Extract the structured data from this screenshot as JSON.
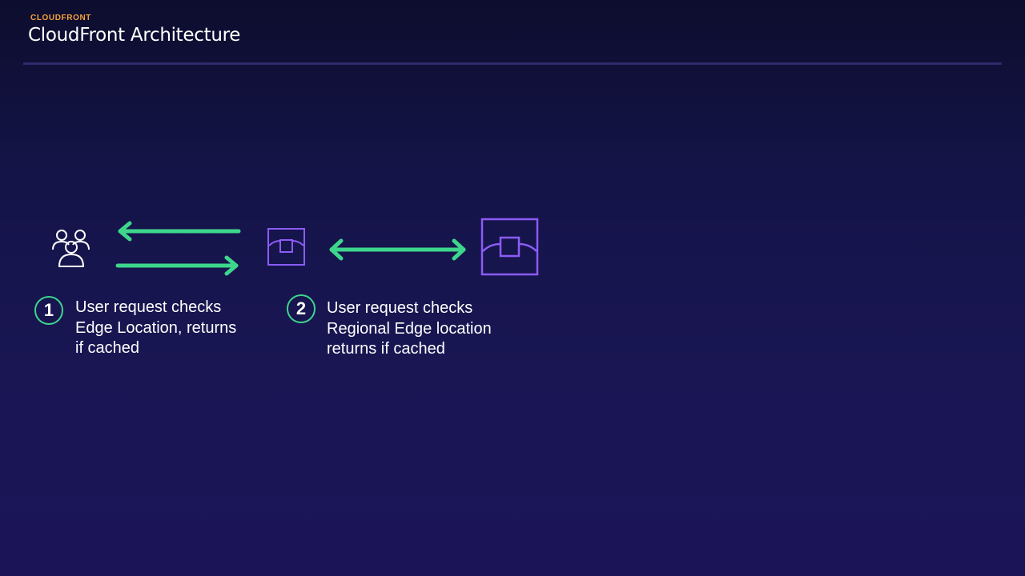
{
  "header": {
    "eyebrow": "CLOUDFRONT",
    "title": "CloudFront Architecture"
  },
  "icons": {
    "users": "users-group-icon",
    "edge_location": "edge-location-icon",
    "regional_edge": "regional-edge-cache-icon"
  },
  "colors": {
    "accent_green": "#3dd68c",
    "accent_purple": "#8b5cf6",
    "eyebrow_orange": "#f5a03a"
  },
  "steps": [
    {
      "number": "1",
      "text": "User request checks\nEdge Location, returns\nif cached"
    },
    {
      "number": "2",
      "text": "User request checks\nRegional Edge location\nreturns if cached"
    }
  ]
}
